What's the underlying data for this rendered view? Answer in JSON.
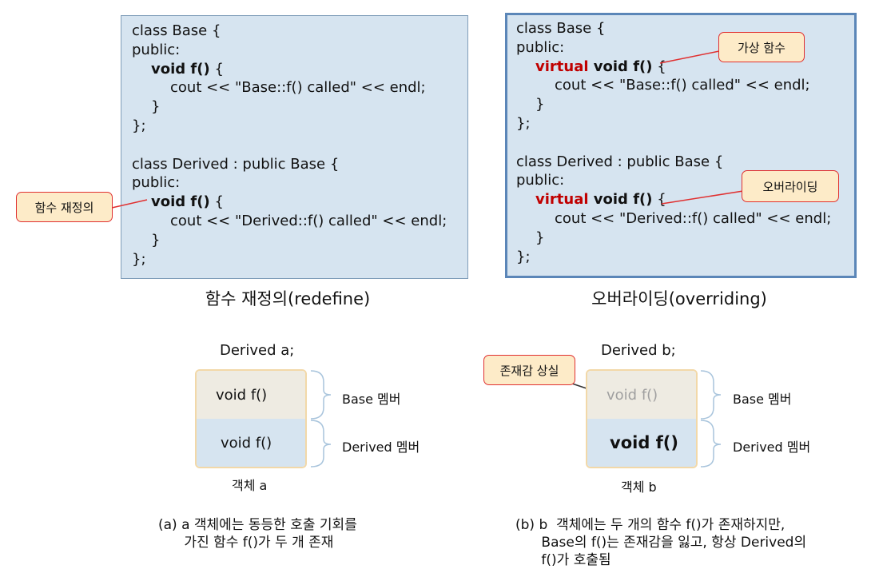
{
  "left_code": {
    "lines": [
      "class Base {",
      "public:",
      "void f()",
      " {",
      "cout << \"Base::f() called\" << endl;",
      "}",
      "};",
      "class Derived : public Base {",
      "public:",
      "void f()",
      " {",
      "cout << \"Derived::f() called\" << endl;",
      "}",
      "};"
    ]
  },
  "right_code": {
    "lines": [
      "class Base {",
      "public:",
      "virtual",
      " void f()",
      " {",
      "cout << \"Base::f() called\" << endl;",
      "}",
      "};",
      "class Derived : public Base {",
      "public:",
      "virtual",
      " void f()",
      " {",
      "cout << \"Derived::f() called\" << endl;",
      "}",
      "};"
    ]
  },
  "callouts": {
    "redefine": "함수 재정의",
    "virtual_func": "가상 함수",
    "overriding": "오버라이딩",
    "lost_presence": "존재감 상실"
  },
  "captions": {
    "left": "함수 재정의(redefine)",
    "right": "오버라이딩(overriding)"
  },
  "objects": {
    "a": {
      "decl": "Derived a;",
      "top_label": "void f()",
      "bottom_label": "void f()",
      "name": "객체 a",
      "base_member": "Base 멤버",
      "derived_member": "Derived 멤버"
    },
    "b": {
      "decl": "Derived b;",
      "top_label": "void f()",
      "bottom_label": "void f()",
      "name": "객체 b",
      "base_member": "Base 멤버",
      "derived_member": "Derived 멤버"
    }
  },
  "descriptions": {
    "a": "(a) a 객체에는 동등한 호출 기회를\n      가진 함수 f()가 두 개 존재",
    "b": "(b) b  객체에는 두 개의 함수 f()가 존재하지만,\n      Base의 f()는 존재감을 잃고, 항상 Derived의\n      f()가 호출됨"
  },
  "colors": {
    "code_bg": "#d6e4f0",
    "keyword_red": "#c00000",
    "callout_bg": "#fdebc8",
    "callout_border": "#e03030",
    "right_box_border": "#5b86b8",
    "brace_color": "#a8c4dc"
  }
}
